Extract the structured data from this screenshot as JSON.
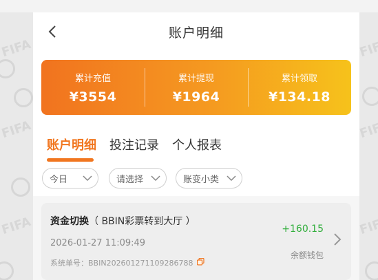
{
  "header": {
    "title": "账户明细"
  },
  "summary": [
    {
      "label": "累计充值",
      "value": "¥3554"
    },
    {
      "label": "累计提现",
      "value": "¥1964"
    },
    {
      "label": "累计领取",
      "value": "¥134.18"
    }
  ],
  "tabs": [
    {
      "label": "账户明细",
      "active": true
    },
    {
      "label": "投注记录",
      "active": false
    },
    {
      "label": "个人报表",
      "active": false
    }
  ],
  "filters": [
    {
      "value": "今日"
    },
    {
      "value": "请选择"
    },
    {
      "value": "账变小类"
    }
  ],
  "record": {
    "title": "资金切换",
    "subtitle": "（ BBIN彩票转到大厅 ）",
    "time": "2026-01-27 11:09:49",
    "order_label": "系统单号：",
    "order_no": "BBIN20260127110928678​8",
    "amount": "+160.15",
    "wallet": "余额钱包"
  },
  "colors": {
    "accent": "#f1761f",
    "gradient_start": "#f1731f",
    "gradient_end": "#f6c21b",
    "amount_positive": "#2fae3a"
  },
  "background_text": "FIFA"
}
